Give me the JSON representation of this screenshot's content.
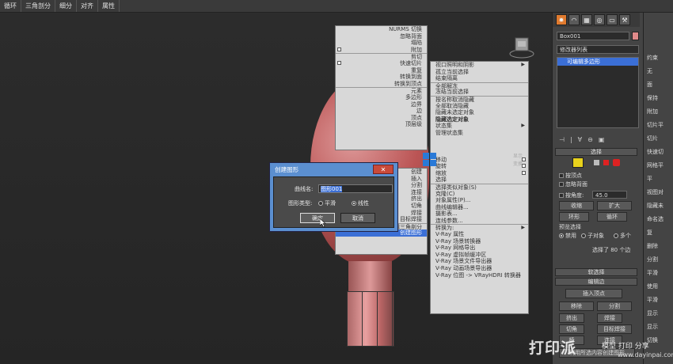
{
  "topbar": {
    "items": [
      "循环",
      "三角剖分",
      "细分",
      "对齐",
      "属性"
    ]
  },
  "viewport": {
    "label": ""
  },
  "quad_left": {
    "items": [
      "NURMS 切换",
      "忽略背面",
      "塌陷",
      "附加",
      "剪切",
      "快速切片",
      "重复",
      "转换到面",
      "转换到顶点",
      "元素",
      "多边形",
      "边界",
      "边",
      "顶点",
      "顶层级",
      "",
      "",
      "",
      "创建",
      "插入",
      "分割",
      "连接",
      "挤出",
      "切角",
      "焊接",
      "目标焊接",
      "编辑三角剖分",
      "创建图形"
    ]
  },
  "quad_right": {
    "items": [
      "视口照明和阴影",
      "孤立当前选择",
      "结束隔离",
      "全部解冻",
      "冻结当前选择",
      "按名称取消隐藏",
      "全部取消隐藏",
      "隐藏未选定对象",
      "隐藏选定对象",
      "状态集",
      "管理状态集",
      "",
      "",
      "",
      "移动",
      "旋转",
      "缩放",
      "选择",
      "选择类似对象(S)",
      "克隆(C)",
      "对象属性(P)...",
      "曲线编辑器...",
      "摄影表...",
      "连线参数...",
      "转换为:",
      "V-Ray 属性",
      "V-Ray 场景转换器",
      "V-Ray 网格导出",
      "V-Ray 虚拟帧缓冲区",
      "V-Ray 场景文件导出器",
      "V-Ray 动画场景导出器",
      "V-Ray 位图 -> VRayHDRI 转换器"
    ]
  },
  "quad_labels": {
    "display": "显示",
    "transform": "变换"
  },
  "dialog": {
    "title": "创建图形",
    "curve_name_label": "曲线名:",
    "curve_name_value": "图形001",
    "shape_type_label": "图形类型:",
    "smooth_label": "平滑",
    "linear_label": "线性",
    "ok_label": "确定",
    "cancel_label": "取消",
    "close_label": "✕"
  },
  "panel": {
    "object_name": "Box001",
    "modifier_list": "修改器列表",
    "stack_item": "可编辑多边形",
    "selection_title": "选择",
    "by_vertex": "按顶点",
    "ignore_backface": "忽略背面",
    "by_angle": "按角度:",
    "angle_value": "45.0",
    "shrink": "收缩",
    "grow": "扩大",
    "ring": "环形",
    "loop": "循环",
    "preview_title": "预览选择",
    "disabled": "禁用",
    "sub_object": "子对象",
    "multiple": "多个",
    "selection_status": "选择了 80 个边",
    "soft_selection": "软选择",
    "edit_edges": "编辑边",
    "insert_vertex": "插入顶点",
    "remove": "移除",
    "split": "分割",
    "extrude": "挤出",
    "weld": "焊接",
    "chamfer": "切角",
    "target_weld": "目标焊接",
    "bridge": "桥",
    "connect": "连接",
    "create_shape": "利用所选内容创建图形"
  },
  "panel2": {
    "items": [
      "约束",
      "无",
      "面",
      "保持",
      "附加",
      "切片平",
      "切片",
      "快速切",
      "网格平",
      "平",
      "视图对",
      "隐藏未",
      "命名选",
      "复",
      "删除",
      "分割",
      "平滑",
      "使用",
      "平滑",
      "显示",
      "显示",
      "切换"
    ]
  },
  "watermark": {
    "brand": "打印派",
    "sub": "模型 打印 分享",
    "url": "www.dayinpai.com"
  },
  "colors": {
    "accent": "#3b6fd6",
    "model": "#b55555",
    "titlebar": "#5b8fd0"
  }
}
